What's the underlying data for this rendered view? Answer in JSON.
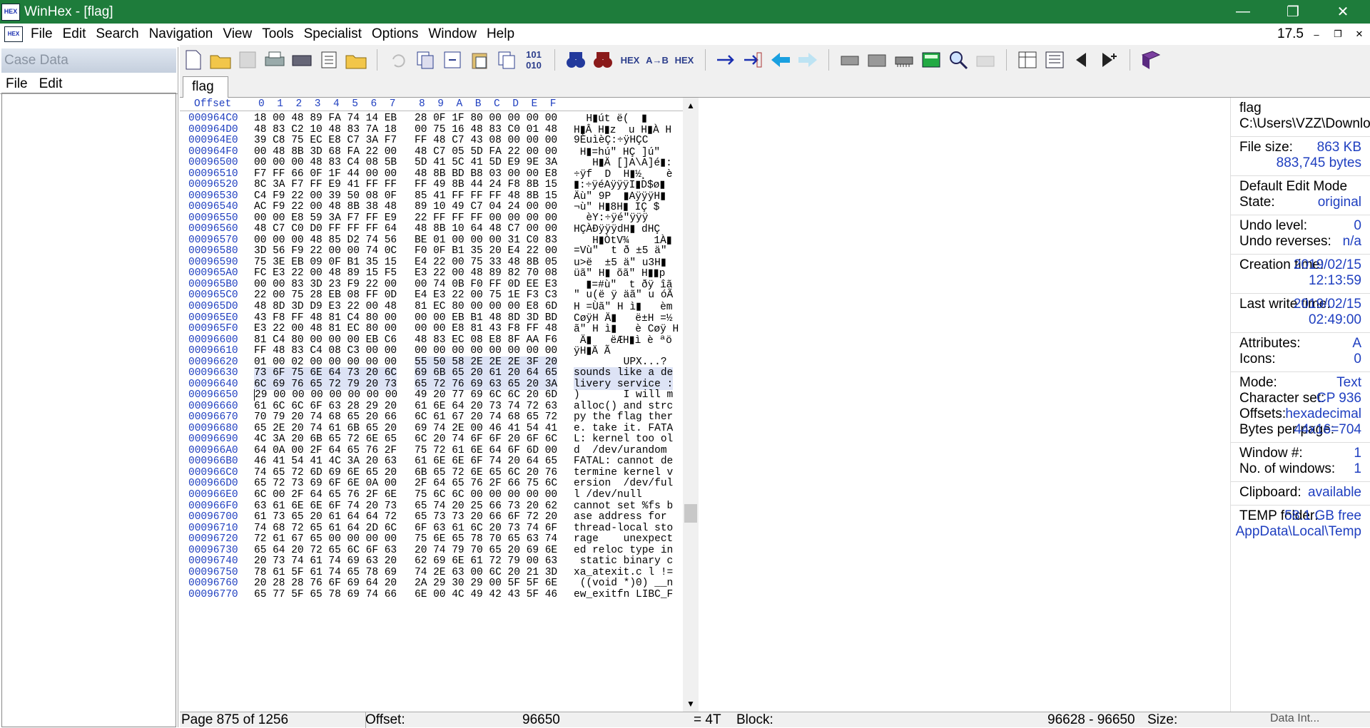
{
  "window": {
    "title": "WinHex - [flag]"
  },
  "menu": {
    "items": [
      "File",
      "Edit",
      "Search",
      "Navigation",
      "View",
      "Tools",
      "Specialist",
      "Options",
      "Window",
      "Help"
    ],
    "version": "17.5"
  },
  "left": {
    "header": "Case Data",
    "menu": [
      "File",
      "Edit"
    ]
  },
  "tab": {
    "label": "flag"
  },
  "hex": {
    "header_offset": "Offset",
    "columns": [
      "0",
      "1",
      "2",
      "3",
      "4",
      "5",
      "6",
      "7",
      "8",
      "9",
      "A",
      "B",
      "C",
      "D",
      "E",
      "F"
    ],
    "rows": [
      {
        "off": "000964C0",
        "h1": "18 00 48 89 FA 74 14 EB",
        "h2": "28 0F 1F 80 00 00 00 00",
        "t": "  H▮út ë(  ▮    "
      },
      {
        "off": "000964D0",
        "h1": "48 83 C2 10 48 83 7A 18",
        "h2": "00 75 16 48 83 C0 01 48",
        "t": "H▮Â H▮z  u H▮À H"
      },
      {
        "off": "000964E0",
        "h1": "39 C8 75 EC E8 C7 3A F7",
        "h2": "FF 48 C7 43 08 00 00 00",
        "t": "9ÈuìèÇ:÷ÿHÇC    "
      },
      {
        "off": "000964F0",
        "h1": "00 48 8B 3D 68 FA 22 00",
        "h2": "48 C7 05 5D FA 22 00 00",
        "t": " H▮=hú\" HÇ ]ú\"  "
      },
      {
        "off": "00096500",
        "h1": "00 00 00 48 83 C4 08 5B",
        "h2": "5D 41 5C 41 5D E9 9E 3A",
        "t": "   H▮Ä []A\\A]é▮:"
      },
      {
        "off": "00096510",
        "h1": "F7 FF 66 0F 1F 44 00 00",
        "h2": "48 8B BD B8 03 00 00 E8",
        "t": "÷ÿf  D  H▮½¸   è"
      },
      {
        "off": "00096520",
        "h1": "8C 3A F7 FF E9 41 FF FF",
        "h2": "FF 49 8B 44 24 F8 8B 15",
        "t": "▮:÷ÿéAÿÿÿI▮D$ø▮ "
      },
      {
        "off": "00096530",
        "h1": "C4 F9 22 00 39 50 08 0F",
        "h2": "85 41 FF FF FF 48 8B 15",
        "t": "Äù\" 9P  ▮AÿÿÿH▮ "
      },
      {
        "off": "00096540",
        "h1": "AC F9 22 00 48 8B 38 48",
        "h2": "89 10 49 C7 04 24 00 00",
        "t": "¬ù\" H▮8H▮ IÇ $  "
      },
      {
        "off": "00096550",
        "h1": "00 00 E8 59 3A F7 FF E9",
        "h2": "22 FF FF FF 00 00 00 00",
        "t": "  èY:÷ÿé\"ÿÿÿ    "
      },
      {
        "off": "00096560",
        "h1": "48 C7 C0 D0 FF FF FF 64",
        "h2": "48 8B 10 64 48 C7 00 00",
        "t": "HÇÀÐÿÿÿdH▮ dHÇ  "
      },
      {
        "off": "00096570",
        "h1": "00 00 00 48 85 D2 74 56",
        "h2": "BE 01 00 00 00 31 C0 83",
        "t": "   H▮ÒtV¾    1À▮"
      },
      {
        "off": "00096580",
        "h1": "3D 56 F9 22 00 00 74 0C",
        "h2": "F0 0F B1 35 20 E4 22 00",
        "t": "=Vù\"  t ð ±5 ä\" "
      },
      {
        "off": "00096590",
        "h1": "75 3E EB 09 0F B1 35 15",
        "h2": "E4 22 00 75 33 48 8B 05",
        "t": "u>ë  ±5 ä\" u3H▮ "
      },
      {
        "off": "000965A0",
        "h1": "FC E3 22 00 48 89 15 F5",
        "h2": "E3 22 00 48 89 82 70 08",
        "t": "üã\" H▮ õã\" H▮▮p "
      },
      {
        "off": "000965B0",
        "h1": "00 00 83 3D 23 F9 22 00",
        "h2": "00 74 0B F0 FF 0D EE E3",
        "t": "  ▮=#ù\"  t ðÿ îã"
      },
      {
        "off": "000965C0",
        "h1": "22 00 75 28 EB 08 FF 0D",
        "h2": "E4 E3 22 00 75 1E F3 C3",
        "t": "\" u(ë ÿ äã\" u óÃ"
      },
      {
        "off": "000965D0",
        "h1": "48 8D 3D D9 E3 22 00 48",
        "h2": "81 EC 80 00 00 00 E8 6D",
        "t": "H =Ùã\" H ì▮   èm"
      },
      {
        "off": "000965E0",
        "h1": "43 F8 FF 48 81 C4 80 00",
        "h2": "00 00 EB B1 48 8D 3D BD",
        "t": "CøÿH Ä▮   ë±H =½"
      },
      {
        "off": "000965F0",
        "h1": "E3 22 00 48 81 EC 80 00",
        "h2": "00 00 E8 81 43 F8 FF 48",
        "t": "ã\" H ì▮   è Cøÿ H"
      },
      {
        "off": "00096600",
        "h1": "81 C4 80 00 00 00 EB C6",
        "h2": "48 83 EC 08 E8 8F AA F6",
        "t": " Ä▮   ëÆH▮ì è ªö"
      },
      {
        "off": "00096610",
        "h1": "FF 48 83 C4 08 C3 00 00",
        "h2": "00 00 00 00 00 00 00 00",
        "t": "ÿH▮Ä Ã          "
      },
      {
        "off": "00096620",
        "h1": "01 00 02 00 00 00 00 00",
        "h2": "55 50 58 2E 2E 2E 3F 20",
        "t": "        UPX...? ",
        "hl": "h2"
      },
      {
        "off": "00096630",
        "h1": "73 6F 75 6E 64 73 20 6C",
        "h2": "69 6B 65 20 61 20 64 65",
        "t": "sounds like a de",
        "hl": "all"
      },
      {
        "off": "00096640",
        "h1": "6C 69 76 65 72 79 20 73",
        "h2": "65 72 76 69 63 65 20 3A",
        "t": "livery service :",
        "hl": "all"
      },
      {
        "off": "00096650",
        "h1": "29 00 00 00 00 00 00 00",
        "h2": "49 20 77 69 6C 6C 20 6D",
        "t": ")       I will m",
        "hl": "first"
      },
      {
        "off": "00096660",
        "h1": "61 6C 6C 6F 63 28 29 20",
        "h2": "61 6E 64 20 73 74 72 63",
        "t": "alloc() and strc"
      },
      {
        "off": "00096670",
        "h1": "70 79 20 74 68 65 20 66",
        "h2": "6C 61 67 20 74 68 65 72",
        "t": "py the flag ther"
      },
      {
        "off": "00096680",
        "h1": "65 2E 20 74 61 6B 65 20",
        "h2": "69 74 2E 00 46 41 54 41",
        "t": "e. take it. FATA"
      },
      {
        "off": "00096690",
        "h1": "4C 3A 20 6B 65 72 6E 65",
        "h2": "6C 20 74 6F 6F 20 6F 6C",
        "t": "L: kernel too ol"
      },
      {
        "off": "000966A0",
        "h1": "64 0A 00 2F 64 65 76 2F",
        "h2": "75 72 61 6E 64 6F 6D 00",
        "t": "d  /dev/urandom "
      },
      {
        "off": "000966B0",
        "h1": "46 41 54 41 4C 3A 20 63",
        "h2": "61 6E 6E 6F 74 20 64 65",
        "t": "FATAL: cannot de"
      },
      {
        "off": "000966C0",
        "h1": "74 65 72 6D 69 6E 65 20",
        "h2": "6B 65 72 6E 65 6C 20 76",
        "t": "termine kernel v"
      },
      {
        "off": "000966D0",
        "h1": "65 72 73 69 6F 6E 0A 00",
        "h2": "2F 64 65 76 2F 66 75 6C",
        "t": "ersion  /dev/ful"
      },
      {
        "off": "000966E0",
        "h1": "6C 00 2F 64 65 76 2F 6E",
        "h2": "75 6C 6C 00 00 00 00 00",
        "t": "l /dev/null     "
      },
      {
        "off": "000966F0",
        "h1": "63 61 6E 6E 6F 74 20 73",
        "h2": "65 74 20 25 66 73 20 62",
        "t": "cannot set %fs b"
      },
      {
        "off": "00096700",
        "h1": "61 73 65 20 61 64 64 72",
        "h2": "65 73 73 20 66 6F 72 20",
        "t": "ase address for "
      },
      {
        "off": "00096710",
        "h1": "74 68 72 65 61 64 2D 6C",
        "h2": "6F 63 61 6C 20 73 74 6F",
        "t": "thread-local sto"
      },
      {
        "off": "00096720",
        "h1": "72 61 67 65 00 00 00 00",
        "h2": "75 6E 65 78 70 65 63 74",
        "t": "rage    unexpect"
      },
      {
        "off": "00096730",
        "h1": "65 64 20 72 65 6C 6F 63",
        "h2": "20 74 79 70 65 20 69 6E",
        "t": "ed reloc type in"
      },
      {
        "off": "00096740",
        "h1": "20 73 74 61 74 69 63 20",
        "h2": "62 69 6E 61 72 79 00 63",
        "t": " static binary c"
      },
      {
        "off": "00096750",
        "h1": "78 61 5F 61 74 65 78 69",
        "h2": "74 2E 63 00 6C 20 21 3D",
        "t": "xa_atexit.c l !="
      },
      {
        "off": "00096760",
        "h1": "20 28 28 76 6F 69 64 20",
        "h2": "2A 29 30 29 00 5F 5F 6E",
        "t": " ((void *)0) __n"
      },
      {
        "off": "00096770",
        "h1": "65 77 5F 65 78 69 74 66",
        "h2": "6E 00 4C 49 42 43 5F 46",
        "t": "ew_exitfn LIBC_F"
      }
    ]
  },
  "info": {
    "file_name": "flag",
    "file_path": "C:\\Users\\VZZ\\Downlo",
    "file_size_label": "File size:",
    "file_size_kb": "863 KB",
    "file_size_bytes": "883,745 bytes",
    "edit_mode_label": "Default Edit Mode",
    "state_label": "State:",
    "state_value": "original",
    "undo_level_label": "Undo level:",
    "undo_level_value": "0",
    "undo_rev_label": "Undo reverses:",
    "undo_rev_value": "n/a",
    "creation_label": "Creation time:",
    "creation_date": "2019/02/15",
    "creation_time": "12:13:59",
    "lastwrite_label": "Last write time:",
    "lastwrite_date": "2019/02/15",
    "lastwrite_time": "02:49:00",
    "attributes_label": "Attributes:",
    "attributes_value": "A",
    "icons_label": "Icons:",
    "icons_value": "0",
    "mode_label": "Mode:",
    "mode_value": "Text",
    "charset_label": "Character set:",
    "charset_value": "CP 936",
    "offsets_label": "Offsets:",
    "offsets_value": "hexadecimal",
    "bpp_label": "Bytes per page:",
    "bpp_value": "44x16=704",
    "window_label": "Window #:",
    "window_value": "1",
    "nwin_label": "No. of windows:",
    "nwin_value": "1",
    "clipboard_label": "Clipboard:",
    "clipboard_value": "available",
    "temp_label": "TEMP folder:",
    "temp_value": "58.1 GB free",
    "temp_path": "AppData\\Local\\Temp"
  },
  "status": {
    "page": "Page 875 of 1256",
    "offset_label": "Offset:",
    "offset_value": "96650",
    "equals": "= 4T",
    "block_label": "Block:",
    "block_value": "96628 - 96650",
    "size_label": "Size:",
    "data_int": "Data Int..."
  }
}
